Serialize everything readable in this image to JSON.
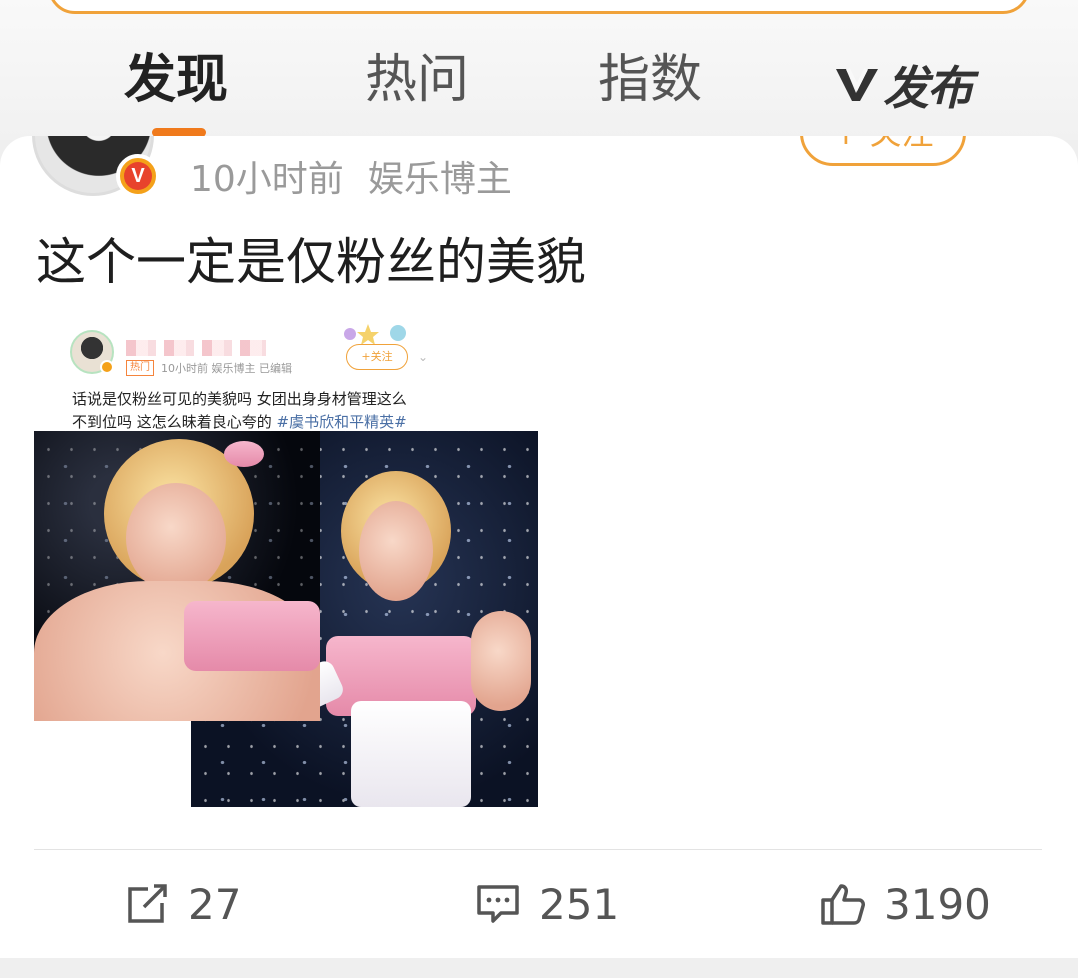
{
  "tabs": [
    {
      "label": "发现",
      "active": true
    },
    {
      "label": "热问",
      "active": false
    },
    {
      "label": "指数",
      "active": false
    }
  ],
  "publish": {
    "label": "发布",
    "icon": "v-logo-icon"
  },
  "post": {
    "time": "10小时前",
    "role": "娱乐博主",
    "follow_label": "+ 关注",
    "text": "这个一定是仅粉丝的美貌",
    "verified_badge": "V"
  },
  "embedded": {
    "hot_badge": "热门",
    "meta": "10小时前  娱乐博主  已编辑",
    "follow_label": "+关注",
    "line1": "话说是仅粉丝可见的美貌吗 女团出身身材管理这么",
    "line2_prefix": "不到位吗 这怎么昧着良心夸的 ",
    "hashtag": "#虞书欣和平精英#"
  },
  "actions": {
    "share_count": "27",
    "comment_count": "251",
    "like_count": "3190"
  },
  "colors": {
    "accent_orange": "#f0a23a",
    "tab_indicator": "#f07a1c",
    "hashtag_blue": "#4a6fa5"
  }
}
